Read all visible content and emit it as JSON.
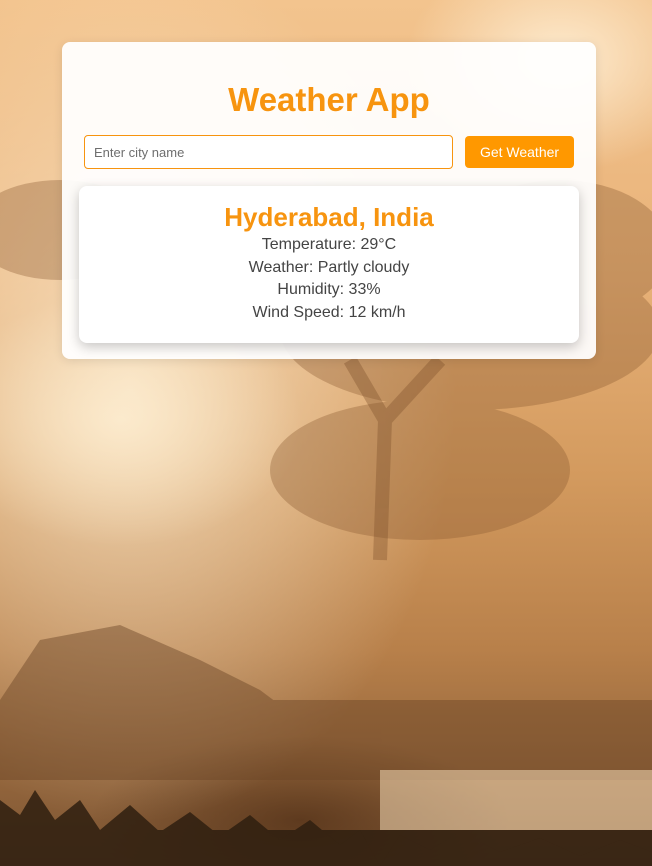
{
  "app": {
    "title": "Weather App"
  },
  "search": {
    "placeholder": "Enter city name",
    "value": "",
    "button_label": "Get Weather"
  },
  "result": {
    "city": "Hyderabad, India",
    "temperature": "Temperature: 29°C",
    "weather": "Weather: Partly cloudy",
    "humidity": "Humidity: 33%",
    "wind_speed": "Wind Speed: 12 km/h"
  },
  "colors": {
    "accent": "#f7940f",
    "button": "#ff9800",
    "text": "#444444"
  }
}
